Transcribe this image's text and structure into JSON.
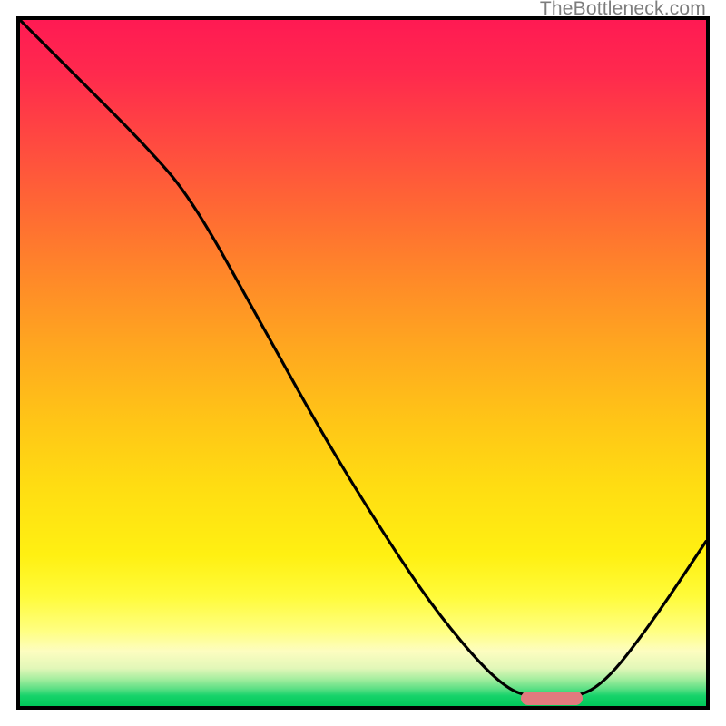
{
  "watermark": "TheBottleneck.com",
  "chart_data": {
    "type": "line",
    "title": "",
    "xlabel": "",
    "ylabel": "",
    "xlim": [
      0,
      100
    ],
    "ylim": [
      0,
      100
    ],
    "grid": false,
    "legend": false,
    "background": "red-yellow-green vertical gradient",
    "series": [
      {
        "name": "bottleneck-curve",
        "x": [
          0,
          8,
          18,
          25,
          35,
          45,
          55,
          62,
          70,
          75,
          80,
          85,
          92,
          100
        ],
        "values": [
          100,
          92,
          82,
          74,
          56,
          38,
          22,
          12,
          3,
          1,
          1,
          3,
          12,
          24
        ]
      }
    ],
    "marker": {
      "x_start": 73,
      "x_end": 82,
      "y": 0.5,
      "color": "#e17a7e"
    },
    "gradient_stops": [
      {
        "pct": 0,
        "color": "#ff1a53"
      },
      {
        "pct": 50,
        "color": "#ffc417"
      },
      {
        "pct": 90,
        "color": "#ffff80"
      },
      {
        "pct": 100,
        "color": "#00c95a"
      }
    ]
  }
}
